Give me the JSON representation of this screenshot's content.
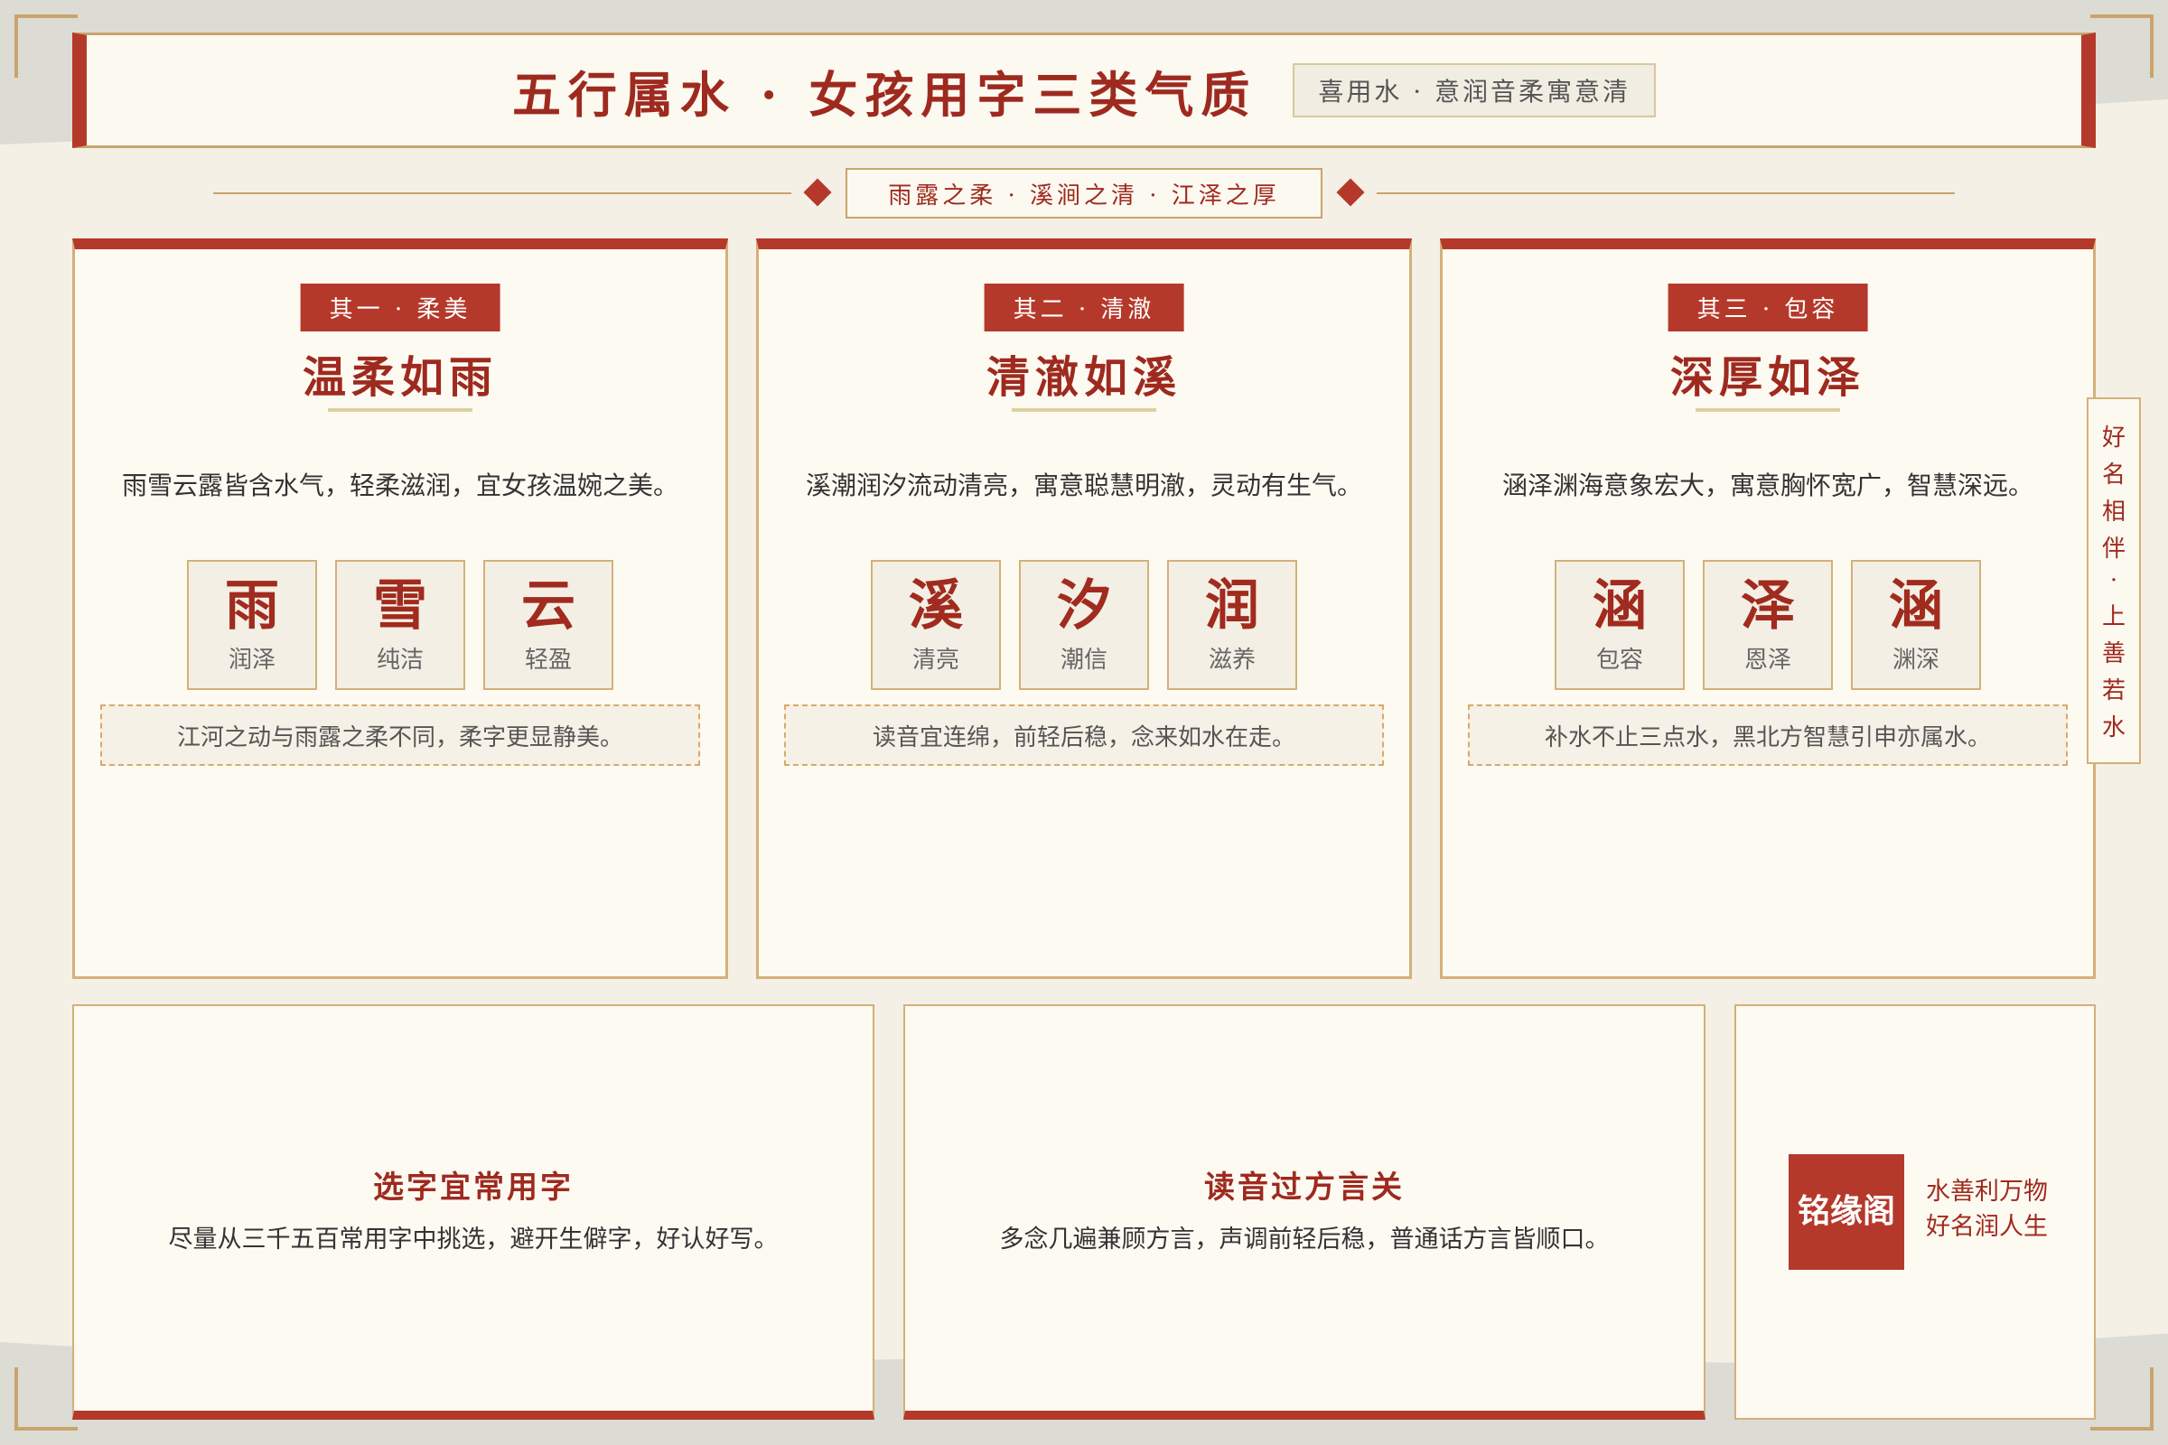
{
  "header": {
    "title": "五行属水 · 女孩用字三类气质",
    "tag": "喜用水 · 意润音柔寓意清"
  },
  "subtitle": "雨露之柔 · 溪涧之清 · 江泽之厚",
  "cards": [
    {
      "badge": "其一 · 柔美",
      "heading": "温柔如雨",
      "desc": "雨雪云露皆含水气，轻柔滋润，宜女孩温婉之美。",
      "chars": [
        {
          "char": "雨",
          "meaning": "润泽"
        },
        {
          "char": "雪",
          "meaning": "纯洁"
        },
        {
          "char": "云",
          "meaning": "轻盈"
        }
      ],
      "note": "江河之动与雨露之柔不同，柔字更显静美。"
    },
    {
      "badge": "其二 · 清澈",
      "heading": "清澈如溪",
      "desc": "溪潮润汐流动清亮，寓意聪慧明澈，灵动有生气。",
      "chars": [
        {
          "char": "溪",
          "meaning": "清亮"
        },
        {
          "char": "汐",
          "meaning": "潮信"
        },
        {
          "char": "润",
          "meaning": "滋养"
        }
      ],
      "note": "读音宜连绵，前轻后稳，念来如水在走。"
    },
    {
      "badge": "其三 · 包容",
      "heading": "深厚如泽",
      "desc": "涵泽渊海意象宏大，寓意胸怀宽广，智慧深远。",
      "chars": [
        {
          "char": "涵",
          "meaning": "包容"
        },
        {
          "char": "泽",
          "meaning": "恩泽"
        },
        {
          "char": "涵",
          "meaning": "渊深"
        }
      ],
      "note": "补水不止三点水，黑北方智慧引申亦属水。"
    }
  ],
  "side_note": [
    "好",
    "名",
    "相",
    "伴",
    "·",
    "上",
    "善",
    "若",
    "水"
  ],
  "tips": [
    {
      "title": "选字宜常用字",
      "body": "尽量从三千五百常用字中挑选，避开生僻字，好认好写。"
    },
    {
      "title": "读音过方言关",
      "body": "多念几遍兼顾方言，声调前轻后稳，普通话方言皆顺口。"
    }
  ],
  "brand": {
    "seal": "铭缘阁",
    "slogan_line1": "水善利万物",
    "slogan_line2": "好名润人生"
  },
  "colors": {
    "accent_red": "#b5392b",
    "gold_border": "#c9a46c",
    "paper": "#fdfaf2"
  }
}
